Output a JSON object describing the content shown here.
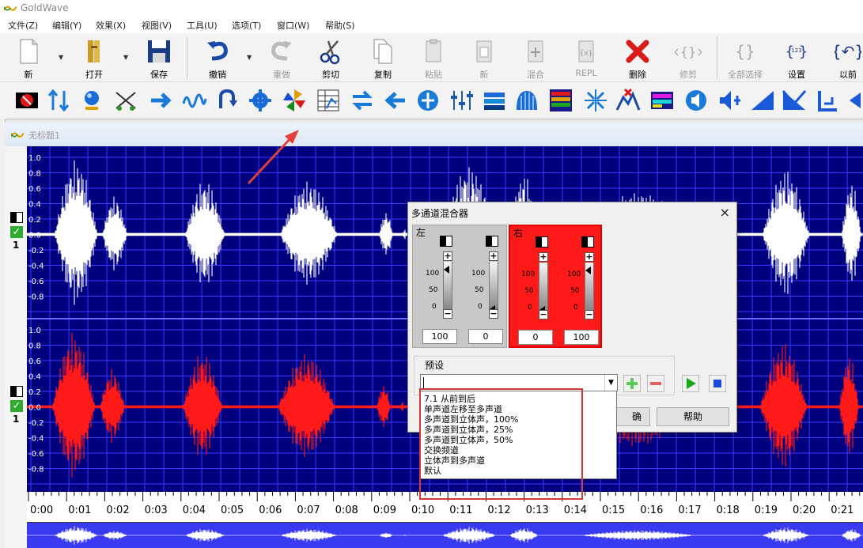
{
  "app": {
    "title": "GoldWave"
  },
  "menu": [
    "文件(Z)",
    "编辑(Y)",
    "效果(X)",
    "视图(V)",
    "工具(U)",
    "选项(T)",
    "窗口(W)",
    "帮助(S)"
  ],
  "toolbar": [
    {
      "key": "new",
      "label": "新",
      "icon": "new-file-icon",
      "enabled": true
    },
    {
      "key": "open",
      "label": "打开",
      "icon": "open-folder-icon",
      "enabled": true
    },
    {
      "key": "save",
      "label": "保存",
      "icon": "save-disk-icon",
      "enabled": true
    },
    {
      "key": "undo",
      "label": "撤销",
      "icon": "undo-icon",
      "enabled": true
    },
    {
      "key": "redo",
      "label": "重做",
      "icon": "redo-icon",
      "enabled": false
    },
    {
      "key": "cut",
      "label": "剪切",
      "icon": "scissors-icon",
      "enabled": true
    },
    {
      "key": "copy",
      "label": "复制",
      "icon": "copy-icon",
      "enabled": true
    },
    {
      "key": "paste",
      "label": "粘贴",
      "icon": "paste-icon",
      "enabled": false
    },
    {
      "key": "paste-new",
      "label": "新",
      "icon": "paste-new-icon",
      "enabled": false
    },
    {
      "key": "mix",
      "label": "混合",
      "icon": "mix-icon",
      "enabled": false
    },
    {
      "key": "repl",
      "label": "REPL",
      "icon": "replace-icon",
      "enabled": false
    },
    {
      "key": "delete",
      "label": "删除",
      "icon": "delete-icon",
      "enabled": true
    },
    {
      "key": "trim",
      "label": "修剪",
      "icon": "trim-icon",
      "enabled": false
    },
    {
      "key": "select-all",
      "label": "全部选择",
      "icon": "select-all-icon",
      "enabled": false
    },
    {
      "key": "settings",
      "label": "设置",
      "icon": "settings-icon",
      "enabled": true
    },
    {
      "key": "previous",
      "label": "以前",
      "icon": "previous-icon",
      "enabled": true
    }
  ],
  "effects_toolbar": [
    "stop-icon",
    "resize-icon",
    "magnify-icon",
    "noise-icon",
    "fade-icon",
    "wave-icon",
    "loop-icon",
    "gear-effect-icon",
    "pinwheel-icon",
    "eq-table-icon",
    "swap-icon",
    "left-arrow-icon",
    "expand-icon",
    "mixer-icon",
    "pan-icon",
    "spectrum-icon",
    "spectrum-bars-icon",
    "compress-icon",
    "mute-icon",
    "color-grid-icon",
    "speaker-icon",
    "volume-cross-icon",
    "fade-in-icon",
    "fade-out-icon",
    "step-icon",
    "play-icon"
  ],
  "document": {
    "title": "无标题1"
  },
  "channels": [
    {
      "number": "1",
      "color": "#ffffff",
      "ticks": [
        "1.0",
        "0.8",
        "0.6",
        "0.4",
        "0.2",
        "0.0",
        "-0.2",
        "-0.4",
        "-0.6",
        "-0.8"
      ]
    },
    {
      "number": "1",
      "color": "#ff1a1a",
      "ticks": [
        "1.0",
        "0.8",
        "0.6",
        "0.4",
        "0.2",
        "0.0",
        "-0.2",
        "-0.4",
        "-0.6",
        "-0.8"
      ]
    }
  ],
  "timeline": [
    "0:00",
    "0:01",
    "0:02",
    "0:03",
    "0:04",
    "0:05",
    "0:06",
    "0:07",
    "0:08",
    "0:09",
    "0:10",
    "0:11",
    "0:12",
    "0:13",
    "0:14",
    "0:15",
    "0:16",
    "0:17",
    "0:18",
    "0:19",
    "0:20",
    "0:21"
  ],
  "dialog": {
    "title": "多通道混合器",
    "close": "×",
    "left_label": "左",
    "right_label": "右",
    "scale": [
      "100",
      "50",
      "0"
    ],
    "channel_values": [
      100,
      0,
      0,
      100
    ],
    "channel_value_labels": [
      "100",
      "0",
      "0",
      "100"
    ],
    "preset_label": "预设",
    "preset_value": "",
    "preset_options": [
      "7.1 从前到后",
      "单声道左移至多声道",
      "多声道到立体声，100%",
      "多声道到立体声，25%",
      "多声道到立体声，50%",
      "交换频道",
      "立体声到多声道",
      "默认"
    ],
    "buttons": {
      "ok_partial": "确",
      "help": "帮助"
    },
    "colors": {
      "left_bg": "#c8c8c8",
      "right_bg": "#ff1a1a",
      "add_green": "#5cc85c",
      "remove_red": "#e06060",
      "play_green": "#1aa81a",
      "stop_blue": "#1a4ad8"
    }
  },
  "colors": {
    "waveform_bg": "#00007e",
    "grid": "#3a3aff",
    "left_wave": "#ffffff",
    "right_wave": "#ff1a1a"
  }
}
